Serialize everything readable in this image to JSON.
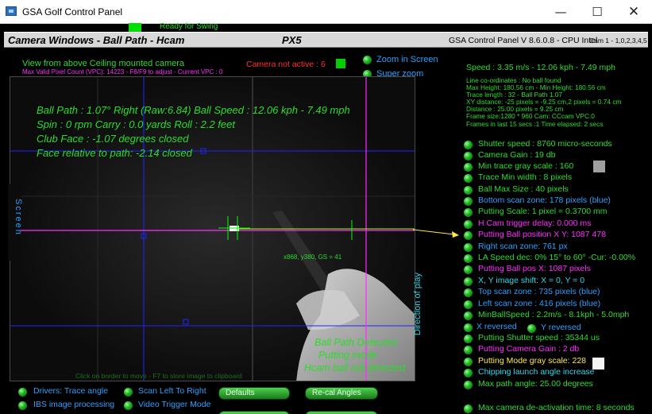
{
  "window": {
    "title": "GSA Golf Control Panel",
    "minimize": "—",
    "maximize": "☐",
    "close": "✕"
  },
  "status": {
    "ready": "Ready for Swing"
  },
  "header": {
    "left": "Camera Windows - Ball Path - Hcam",
    "mid": "PX5",
    "right": "GSA Control Panel V 8.6.0.8 - CPU Intel",
    "cam": "Cam 1 - 1,0,2,3,4,5"
  },
  "camera": {
    "view_label": "View from above Ceiling mounted camera",
    "vpc_line": "Max Valid Pixel Count (VPC): 14223  - F8/F9 to adjust - Current VPC : 0",
    "not_active": "Camera not active : 6",
    "zoom_in_screen": "Zoom in Screen",
    "super_zoom": "Super zoom",
    "shot": [
      "Ball Path : 1.07° Right (Raw:6.84)  Ball Speed : 12.06 kph - 7.49 mph",
      "Spin : 0 rpm   Carry : 0.0 yards  Roll : 2.2 feet",
      "Club Face : -1.07 degrees closed",
      "Face relative to path: -2.14 closed"
    ],
    "screen_label": "Screen",
    "direction_label": "Direction of play",
    "cursor_readout": "x868, y380, GS = 41",
    "detected": [
      "Ball Path Detected",
      "Putting mode",
      "Hcam ball roll detected"
    ],
    "hint": "Click on border to move - F7 to store image to clipboard"
  },
  "right_panel": {
    "speed": "Speed : 3.35 m/s - 12.06 kph - 7.49 mph",
    "info": [
      "Line co-ordinates : No ball found",
      "Max Height: 180.56 cm - Min Height: 180.56 cm",
      "Trace length : 32 - Ball Path 1.07",
      "XY distance: -25 pixels = -9.25 cm,2 pixels = 0.74 cm",
      "Distance : 25.00 pixels = 9.25 cm",
      "Frame size:1280 * 960 Cam: CCcam VPC:0",
      "Frames in last 15 secs :1 Time elapsed:   2 secs"
    ],
    "settings": [
      {
        "label": "Shutter speed : 8760 micro-seconds",
        "color": "g",
        "led": true
      },
      {
        "label": "Camera Gain : 19 db",
        "color": "g",
        "led": true
      },
      {
        "label": "Min trace gray scale : 160",
        "color": "g",
        "led": true
      },
      {
        "label": "Trace Min width : 8 pixels",
        "color": "g",
        "led": true
      },
      {
        "label": "Ball Max Size : 40 pixels",
        "color": "g",
        "led": true
      },
      {
        "label": "Bottom scan zone: 178 pixels (blue)",
        "color": "b",
        "led": true
      },
      {
        "label": "Putting Scale: 1 pixel = 0.3700 mm",
        "color": "g",
        "led": true
      },
      {
        "label": "H Cam trigger delay: 0.000 ms",
        "color": "m",
        "led": true
      },
      {
        "label": "Putting Ball position X Y: 1087 478",
        "color": "m",
        "led": true
      },
      {
        "label": "Right scan zone: 761 px",
        "color": "b",
        "led": true
      },
      {
        "label": "LA Speed dec: 0% 15° to 60° -Cur: -0.00%",
        "color": "g",
        "led": true
      },
      {
        "label": "Putting Ball pos X: 1087 pixels",
        "color": "m",
        "led": true
      },
      {
        "label": "X, Y image shift: X = 0, Y = 0",
        "color": "c",
        "led": true
      },
      {
        "label": "Top scan zone : 735 pixels (blue)",
        "color": "b",
        "led": true
      },
      {
        "label": "Left scan zone : 416 pixels (blue)",
        "color": "b",
        "led": true
      },
      {
        "label": "MinBallSpeed : 2.2m/s - 8.1kph - 5.0mph",
        "color": "g",
        "led": true
      },
      {
        "label": "X reversed",
        "color": "b",
        "led": true
      },
      {
        "label": "Putting Shutter speed : 35344 us",
        "color": "g",
        "led": true
      },
      {
        "label": "Putting Camera Gain : 2 db",
        "color": "m",
        "led": true
      },
      {
        "label": "Putting Mode gray scale: 228",
        "color": "y",
        "led": true
      },
      {
        "label": "Chipping launch angle increase",
        "color": "c",
        "led": true
      },
      {
        "label": "Max path angle: 25.00 degrees",
        "color": "g",
        "led": true
      },
      {
        "label": "Max camera de-activation time: 8 seconds",
        "color": "g",
        "led": true
      }
    ],
    "y_reversed": "Y reversed",
    "swatch_colors": {
      "gray": "#a0a0a0",
      "white": "#f4f4f4"
    }
  },
  "bottom": {
    "drivers_trace": "Drivers: Trace angle",
    "scan_left_to_right": "Scan Left To Right",
    "ibs": "IBS image processing",
    "video_trigger": "Video Trigger Mode",
    "defaults": "Defaults",
    "recal": "Re-cal Angles"
  }
}
